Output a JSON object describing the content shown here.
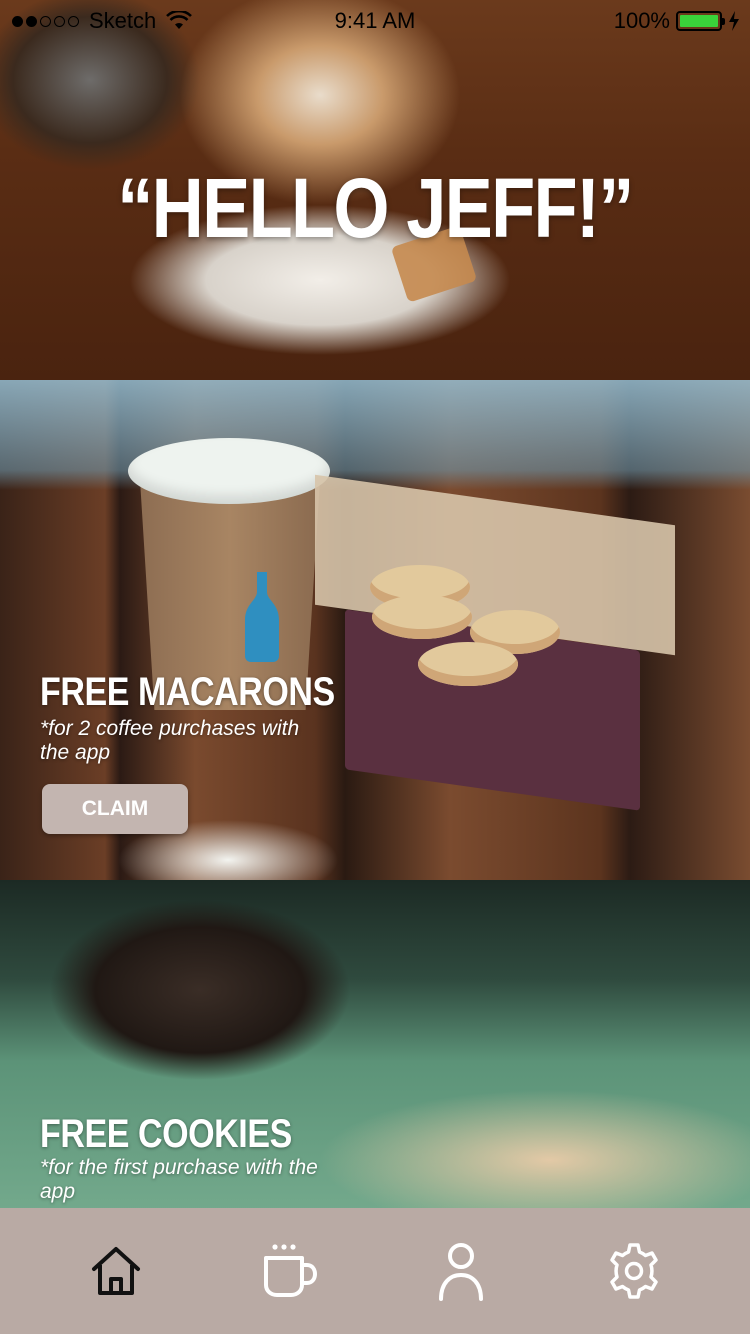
{
  "status_bar": {
    "carrier": "Sketch",
    "time": "9:41 AM",
    "battery_percent": "100%",
    "battery_level": 1.0,
    "signal_bars_filled": 2,
    "signal_bars_total": 5,
    "battery_color": "#3ad23a"
  },
  "hero": {
    "greeting": "“HELLO JEFF!”"
  },
  "offers": [
    {
      "title": "FREE MACARONS",
      "note": "*for 2 coffee purchases with the app",
      "button_label": "CLAIM"
    },
    {
      "title": "FREE COOKIES",
      "note": "*for the first purchase with the app"
    }
  ],
  "tab_bar": {
    "tabs": [
      {
        "icon": "home-icon"
      },
      {
        "icon": "coffee-cup-icon"
      },
      {
        "icon": "user-icon"
      },
      {
        "icon": "gear-icon"
      }
    ],
    "background": "#b9aaa4",
    "active_color": "#111111",
    "inactive_color": "#ffffff"
  },
  "colors": {
    "claim_button": "#c3b5b0"
  }
}
